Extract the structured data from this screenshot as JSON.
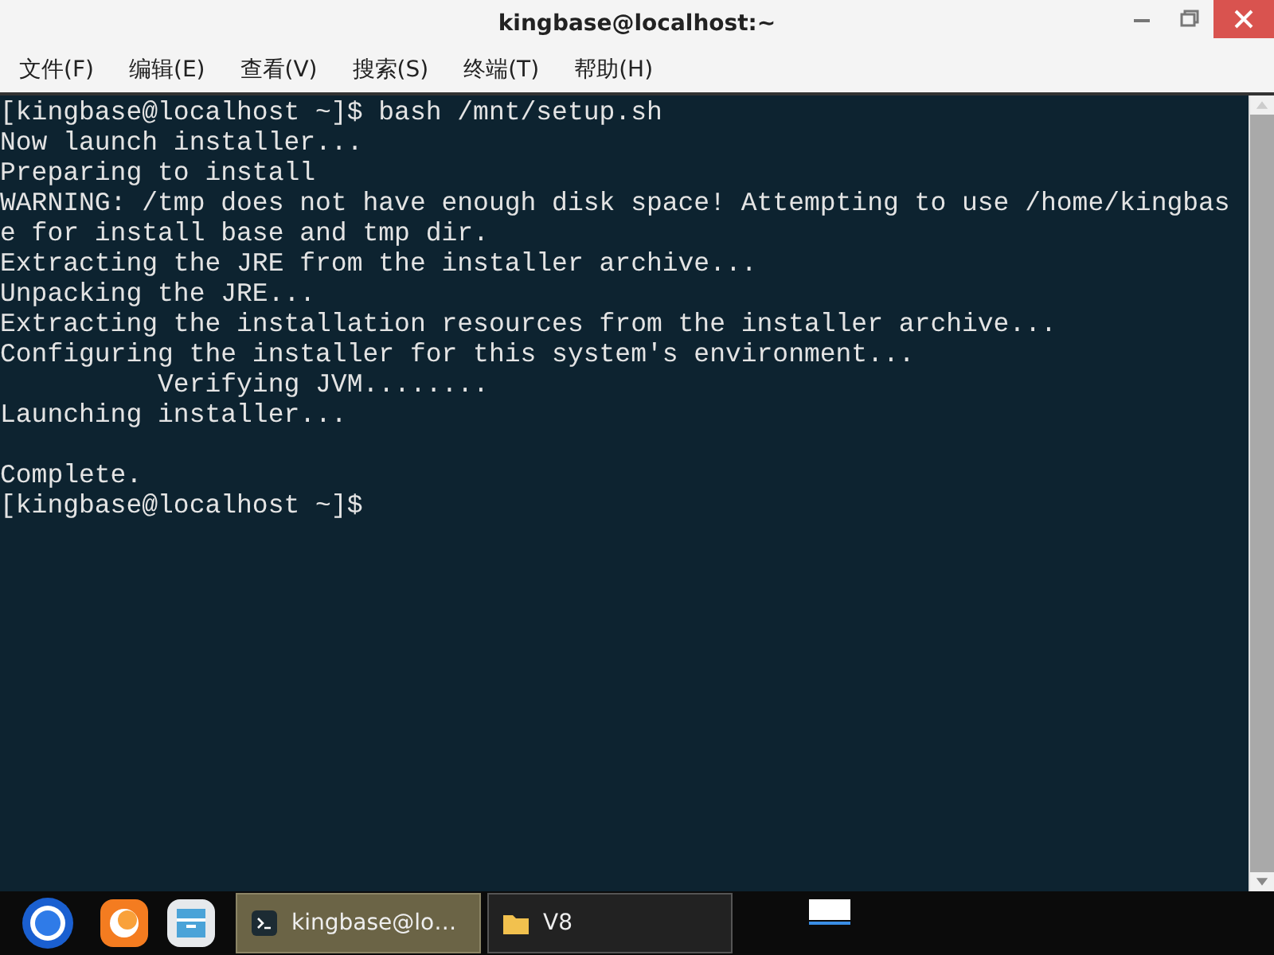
{
  "window": {
    "title": "kingbase@localhost:~"
  },
  "menu": [
    "文件(F)",
    "编辑(E)",
    "查看(V)",
    "搜索(S)",
    "终端(T)",
    "帮助(H)"
  ],
  "terminal": {
    "blocks": [
      {
        "lines": [
          "[kingbase@localhost ~]$ bash /mnt/setup.sh",
          "Now launch installer...",
          "Preparing to install",
          "WARNING: /tmp does not have enough disk space! Attempting to use /home/kingbas",
          "e for install base and tmp dir.",
          "Extracting the JRE from the installer archive...",
          "Unpacking the JRE...",
          "Extracting the installation resources from the installer archive...",
          "Configuring the installer for this system's environment...",
          "          Verifying JVM........",
          "Launching installer..."
        ]
      },
      {
        "lines": [
          "Complete.",
          "[kingbase@localhost ~]$"
        ]
      }
    ]
  },
  "taskbar": {
    "tasks": [
      {
        "kind": "terminal",
        "label": "kingbase@lo…",
        "selected": true
      },
      {
        "kind": "folder",
        "label": "V8",
        "selected": false
      }
    ]
  }
}
